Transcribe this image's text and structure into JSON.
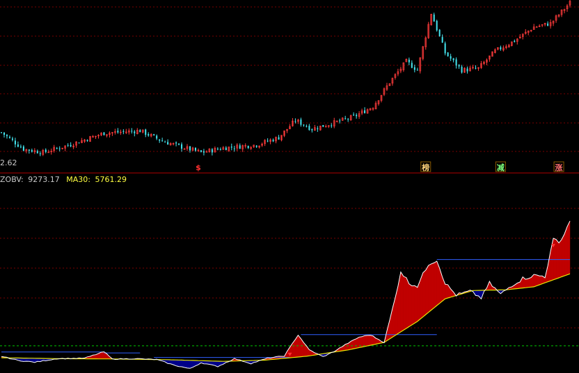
{
  "colors": {
    "background": "#000000",
    "grid": "#7a0000",
    "divider": "#b00000",
    "up_candle": "#ff3b3b",
    "down_candle": "#44e6f0",
    "area_positive": "#c00000",
    "area_negative": "#00008a",
    "zobv_line": "#ffffff",
    "ma30_line": "#e8e800",
    "level_line": "#2f5fff",
    "signal_green_dash": "#00c800",
    "label_gray": "#c8c8c8",
    "label_yellow": "#ffff40"
  },
  "price_panel": {
    "axis_label": "2.62",
    "markers": [
      {
        "label": "$",
        "bar": 71,
        "color": "#ff3030",
        "box": false
      },
      {
        "label": "榜",
        "bar": 153,
        "color": "#ffd27a",
        "box": true
      },
      {
        "label": "减",
        "bar": 180,
        "color": "#7dff7d",
        "box": true
      },
      {
        "label": "涨",
        "bar": 201,
        "color": "#ff7070",
        "box": true
      }
    ]
  },
  "indicator_panel": {
    "zobv_name": "ZOBV:",
    "zobv_value": "9273.17",
    "ma30_name": "MA30:",
    "ma30_value": "5761.29"
  },
  "chart_data": [
    {
      "type": "line",
      "description_kind": "candlestick",
      "bars": 206,
      "price_keypoints": [
        {
          "bar": 0,
          "close": 3.2
        },
        {
          "bar": 8,
          "close": 2.72
        },
        {
          "bar": 15,
          "close": 2.62
        },
        {
          "bar": 25,
          "close": 2.85
        },
        {
          "bar": 37,
          "close": 3.18
        },
        {
          "bar": 50,
          "close": 3.25
        },
        {
          "bar": 58,
          "close": 2.95
        },
        {
          "bar": 65,
          "close": 2.78
        },
        {
          "bar": 72,
          "close": 2.62
        },
        {
          "bar": 80,
          "close": 2.75
        },
        {
          "bar": 92,
          "close": 2.84
        },
        {
          "bar": 100,
          "close": 3.05
        },
        {
          "bar": 106,
          "close": 3.55
        },
        {
          "bar": 112,
          "close": 3.3
        },
        {
          "bar": 120,
          "close": 3.48
        },
        {
          "bar": 127,
          "close": 3.65
        },
        {
          "bar": 134,
          "close": 3.95
        },
        {
          "bar": 140,
          "close": 4.65
        },
        {
          "bar": 146,
          "close": 5.25
        },
        {
          "bar": 150,
          "close": 5.0
        },
        {
          "bar": 155,
          "close": 6.65
        },
        {
          "bar": 160,
          "close": 5.5
        },
        {
          "bar": 166,
          "close": 5.0
        },
        {
          "bar": 172,
          "close": 5.05
        },
        {
          "bar": 178,
          "close": 5.55
        },
        {
          "bar": 185,
          "close": 5.85
        },
        {
          "bar": 192,
          "close": 6.25
        },
        {
          "bar": 198,
          "close": 6.35
        },
        {
          "bar": 205,
          "close": 6.95
        }
      ],
      "ylim": [
        2.45,
        6.95
      ]
    },
    {
      "type": "area",
      "series": [
        {
          "name": "ZOBV",
          "last": 9273.17,
          "keypoints": [
            {
              "bar": 0,
              "v": 280
            },
            {
              "bar": 6,
              "v": 0
            },
            {
              "bar": 12,
              "v": -120
            },
            {
              "bar": 20,
              "v": 120
            },
            {
              "bar": 30,
              "v": 150
            },
            {
              "bar": 37,
              "v": 580
            },
            {
              "bar": 40,
              "v": 90
            },
            {
              "bar": 48,
              "v": 120
            },
            {
              "bar": 56,
              "v": 60
            },
            {
              "bar": 62,
              "v": -300
            },
            {
              "bar": 68,
              "v": -550
            },
            {
              "bar": 72,
              "v": -150
            },
            {
              "bar": 78,
              "v": -400
            },
            {
              "bar": 84,
              "v": 120
            },
            {
              "bar": 90,
              "v": -200
            },
            {
              "bar": 96,
              "v": 150
            },
            {
              "bar": 102,
              "v": 300
            },
            {
              "bar": 107,
              "v": 1700
            },
            {
              "bar": 111,
              "v": 700
            },
            {
              "bar": 116,
              "v": 250
            },
            {
              "bar": 120,
              "v": 600
            },
            {
              "bar": 124,
              "v": 1050
            },
            {
              "bar": 129,
              "v": 1550
            },
            {
              "bar": 133,
              "v": 1700
            },
            {
              "bar": 138,
              "v": 1200
            },
            {
              "bar": 142,
              "v": 4150
            },
            {
              "bar": 144,
              "v": 5950
            },
            {
              "bar": 147,
              "v": 5150
            },
            {
              "bar": 150,
              "v": 4950
            },
            {
              "bar": 154,
              "v": 6450
            },
            {
              "bar": 157,
              "v": 6700
            },
            {
              "bar": 160,
              "v": 5150
            },
            {
              "bar": 164,
              "v": 4350
            },
            {
              "bar": 169,
              "v": 4600
            },
            {
              "bar": 173,
              "v": 4150
            },
            {
              "bar": 176,
              "v": 5150
            },
            {
              "bar": 180,
              "v": 4400
            },
            {
              "bar": 184,
              "v": 5000
            },
            {
              "bar": 188,
              "v": 5450
            },
            {
              "bar": 192,
              "v": 5650
            },
            {
              "bar": 196,
              "v": 5600
            },
            {
              "bar": 199,
              "v": 7950
            },
            {
              "bar": 202,
              "v": 8050
            },
            {
              "bar": 205,
              "v": 9273.17
            }
          ]
        },
        {
          "name": "MA30",
          "last": 5761.29,
          "keypoints": [
            {
              "bar": 0,
              "v": 180
            },
            {
              "bar": 20,
              "v": 120
            },
            {
              "bar": 40,
              "v": 100
            },
            {
              "bar": 60,
              "v": 50
            },
            {
              "bar": 80,
              "v": -60
            },
            {
              "bar": 95,
              "v": 20
            },
            {
              "bar": 110,
              "v": 280
            },
            {
              "bar": 125,
              "v": 700
            },
            {
              "bar": 138,
              "v": 1200
            },
            {
              "bar": 150,
              "v": 2600
            },
            {
              "bar": 160,
              "v": 4100
            },
            {
              "bar": 170,
              "v": 4650
            },
            {
              "bar": 182,
              "v": 4700
            },
            {
              "bar": 192,
              "v": 4900
            },
            {
              "bar": 205,
              "v": 5761.29
            }
          ]
        }
      ],
      "levels": [
        {
          "from_bar": 0,
          "to_bar": 37,
          "v": 560
        },
        {
          "from_bar": 37,
          "to_bar": 50,
          "v": 500
        },
        {
          "from_bar": 55,
          "to_bar": 104,
          "v": 200
        },
        {
          "from_bar": 108,
          "to_bar": 157,
          "v": 1720
        },
        {
          "from_bar": 157,
          "to_bar": 205,
          "v": 6710
        }
      ],
      "signal_level": 970,
      "ylim": [
        -650,
        11500
      ]
    }
  ]
}
